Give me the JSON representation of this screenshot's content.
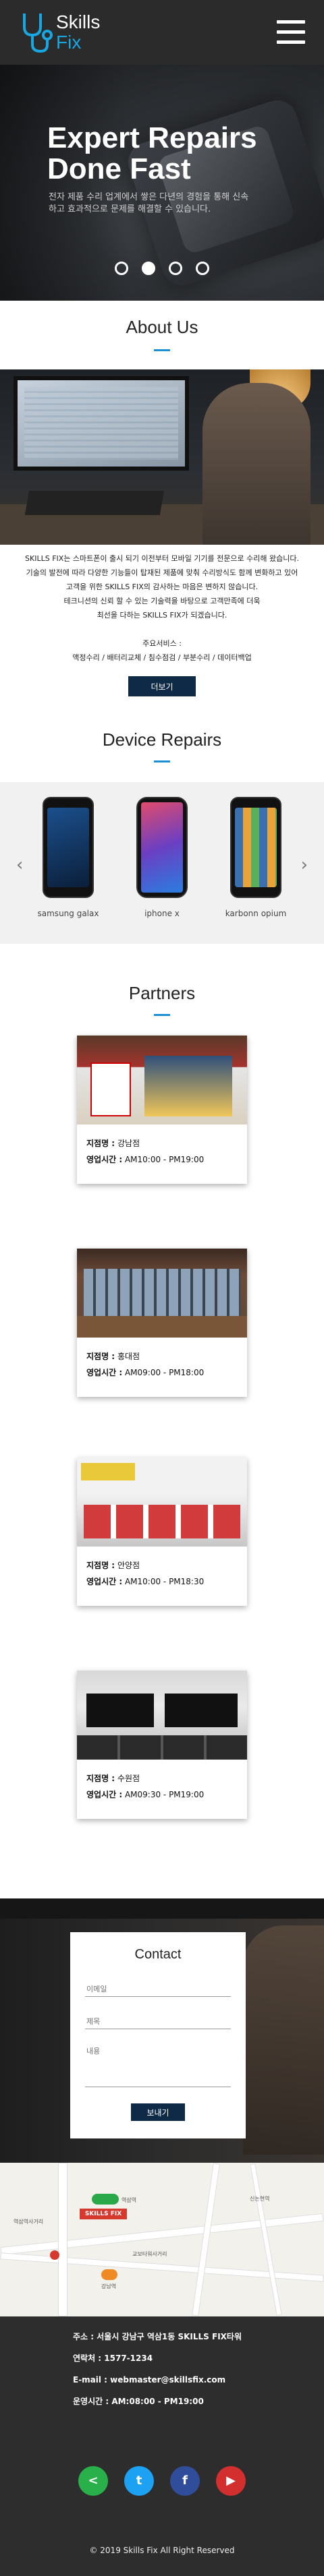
{
  "header": {
    "logo_line1": "Skills",
    "logo_line2": "Fix"
  },
  "hero": {
    "title_line1": "Expert Repairs",
    "title_line2": "Done Fast",
    "subtitle": "전자 제품 수리 업계에서 쌓은 다년의 경험을 통해 신속하고 효과적으로 문제를 해결할 수 있습니다.",
    "slides": 4,
    "active_slide": 2
  },
  "about": {
    "title": "About Us",
    "lines": [
      "SKILLS FIX는 스마트폰이 출시 되기 이전부터 모바일 기기를 전문으로 수리해 왔습니다.",
      "기술의 발전에 따라 다양한 기능들이 탑재된 제품에 맞춰 수리방식도 함께 변화하고 있어",
      "고객을 위한 SKILLS FIX의 감사하는 마음은 변하지 않습니다.",
      "테크니션의 신뢰 할 수 있는 기술력을 바탕으로 고객만족에 더욱",
      "최선을 다하는 SKILLS FIX가 되겠습니다.",
      "",
      "주요서비스 :",
      "액정수리 / 배터리교체 / 침수점검 / 부분수리 / 데이터백업"
    ],
    "more_button": "더보기"
  },
  "devices": {
    "title": "Device Repairs",
    "items": [
      {
        "name": "samsung galax"
      },
      {
        "name": "iphone x"
      },
      {
        "name": "karbonn opium"
      }
    ]
  },
  "partners": {
    "title": "Partners",
    "branch_label": "지점명 :",
    "hours_label": "영업시간 :",
    "items": [
      {
        "branch": "강남점",
        "hours": "AM10:00 - PM19:00"
      },
      {
        "branch": "홍대점",
        "hours": "AM09:00 - PM18:00"
      },
      {
        "branch": "안양점",
        "hours": "AM10:00 - PM18:30"
      },
      {
        "branch": "수원점",
        "hours": "AM09:30 - PM19:00"
      }
    ]
  },
  "contact": {
    "title": "Contact",
    "name_placeholder": "이메일",
    "subject_placeholder": "제목",
    "message_placeholder": "내용",
    "submit": "보내기"
  },
  "map": {
    "labels": [
      "SKILLS FIX",
      "역삼역",
      "강남역",
      "신논현역",
      "교보타워사거리",
      "역삼역사거리"
    ]
  },
  "footer": {
    "address": "주소 : 서울시 강남구 역삼1동 SKILLS FIX타워",
    "phone": "연락처 : 1577-1234",
    "email": "E-mail : webmaster@skillsfix.com",
    "hours": "운영시간 : AM:08:00 - PM19:00",
    "social": [
      {
        "icon": "share-icon",
        "color": "#2ab04a"
      },
      {
        "icon": "twitter-icon",
        "color": "#1da1f2"
      },
      {
        "icon": "facebook-icon",
        "color": "#2f4d9a"
      },
      {
        "icon": "youtube-icon",
        "color": "#d32f2f"
      }
    ],
    "copyright": "© 2019 Skills Fix All Right Reserved"
  },
  "colors": {
    "accent": "#1a8fd6",
    "button": "#0e2a47",
    "header_bg": "#2b2b2b"
  }
}
